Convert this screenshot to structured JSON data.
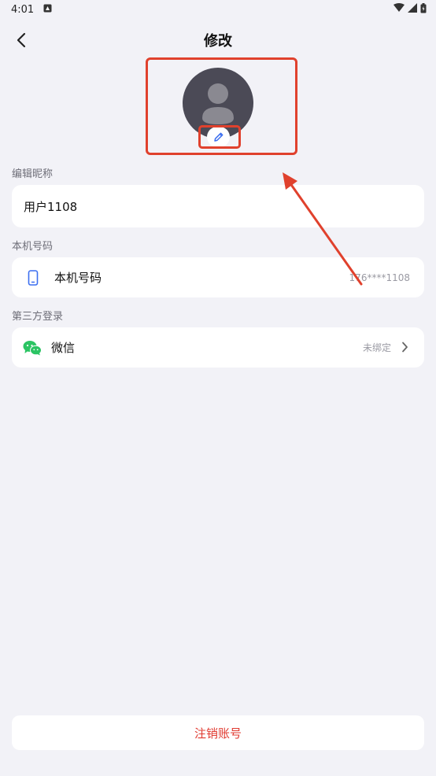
{
  "status_bar": {
    "time": "4:01"
  },
  "header": {
    "title": "修改"
  },
  "nickname_section": {
    "label": "编辑昵称",
    "value": "用户1108"
  },
  "phone_section": {
    "label": "本机号码",
    "row_label": "本机号码",
    "value": "176****1108"
  },
  "third_party_section": {
    "label": "第三方登录",
    "row_label": "微信",
    "value": "未绑定"
  },
  "footer": {
    "deregister_label": "注销账号"
  },
  "colors": {
    "background": "#f2f2f7",
    "annotation": "#e0412d",
    "danger": "#e03a30",
    "wechat": "#2bc463",
    "accent": "#3c6ff0"
  },
  "icons": [
    "back-icon",
    "avatar-placeholder-icon",
    "pencil-icon",
    "phone-icon",
    "wechat-icon",
    "chevron-right-icon"
  ]
}
